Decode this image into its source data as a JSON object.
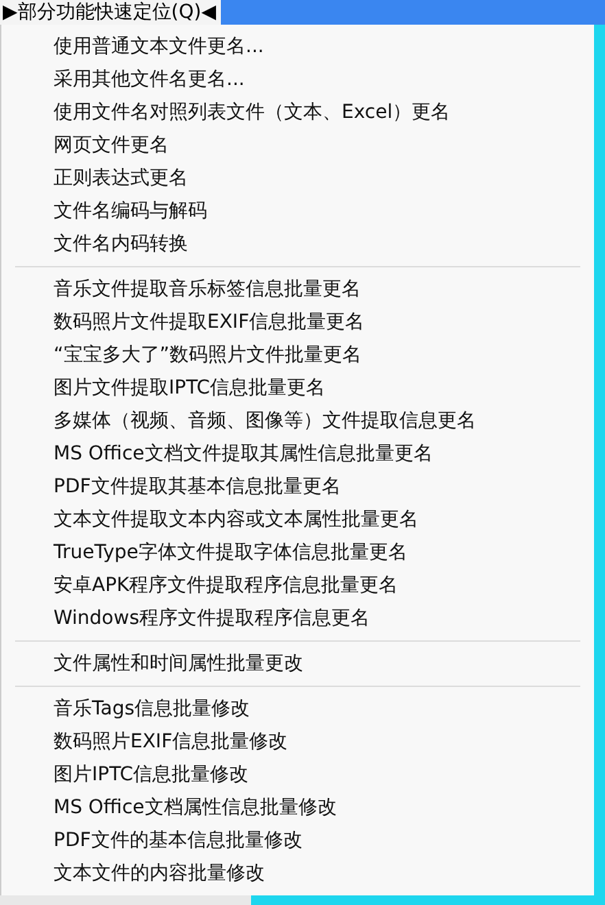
{
  "menu_header": {
    "label": "▶部分功能快速定位(Q)◀"
  },
  "menu": {
    "groups": [
      {
        "items": [
          "使用普通文本文件更名...",
          "采用其他文件名更名...",
          "使用文件名对照列表文件（文本、Excel）更名",
          "网页文件更名",
          "正则表达式更名",
          "文件名编码与解码",
          "文件名内码转换"
        ]
      },
      {
        "items": [
          "音乐文件提取音乐标签信息批量更名",
          "数码照片文件提取EXIF信息批量更名",
          "“宝宝多大了”数码照片文件批量更名",
          "图片文件提取IPTC信息批量更名",
          "多媒体（视频、音频、图像等）文件提取信息更名",
          "MS Office文档文件提取其属性信息批量更名",
          "PDF文件提取其基本信息批量更名",
          "文本文件提取文本内容或文本属性批量更名",
          "TrueType字体文件提取字体信息批量更名",
          "安卓APK程序文件提取程序信息批量更名",
          "Windows程序文件提取程序信息更名"
        ]
      },
      {
        "items": [
          "文件属性和时间属性批量更改"
        ]
      },
      {
        "items": [
          "音乐Tags信息批量修改",
          "数码照片EXIF信息批量修改",
          "图片IPTC信息批量修改",
          "MS Office文档属性信息批量修改",
          "PDF文件的基本信息批量修改",
          "文本文件的内容批量修改"
        ]
      }
    ]
  }
}
